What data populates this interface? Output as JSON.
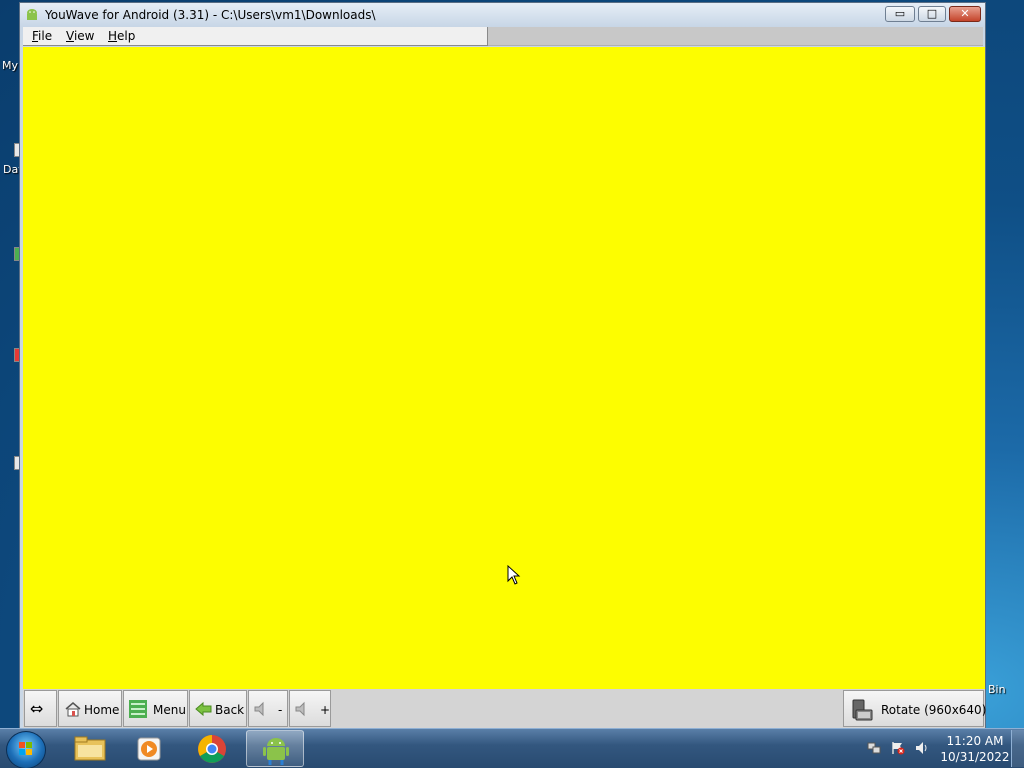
{
  "window": {
    "title": "YouWave for Android (3.31) - C:\\Users\\vm1\\Downloads\\",
    "minimize_glyph": "▭",
    "maximize_glyph": "□",
    "close_glyph": "✕"
  },
  "menu": {
    "file": {
      "underline": "F",
      "rest": "ile"
    },
    "view": {
      "underline": "V",
      "rest": "iew"
    },
    "help": {
      "underline": "H",
      "rest": "elp"
    }
  },
  "screen": {
    "color": "#fdfd00"
  },
  "toolbar": {
    "resize_glyph": "⇔",
    "home_label": "Home",
    "menu_label": "Menu",
    "back_label": "Back",
    "volume_down_label": "-",
    "volume_up_label": "+",
    "rotate_label": "Rotate (960x640)"
  },
  "desktop": {
    "labels": [
      "My",
      "Dat",
      "Bin"
    ]
  },
  "taskbar": {
    "time": "11:20 AM",
    "date": "10/31/2022"
  }
}
